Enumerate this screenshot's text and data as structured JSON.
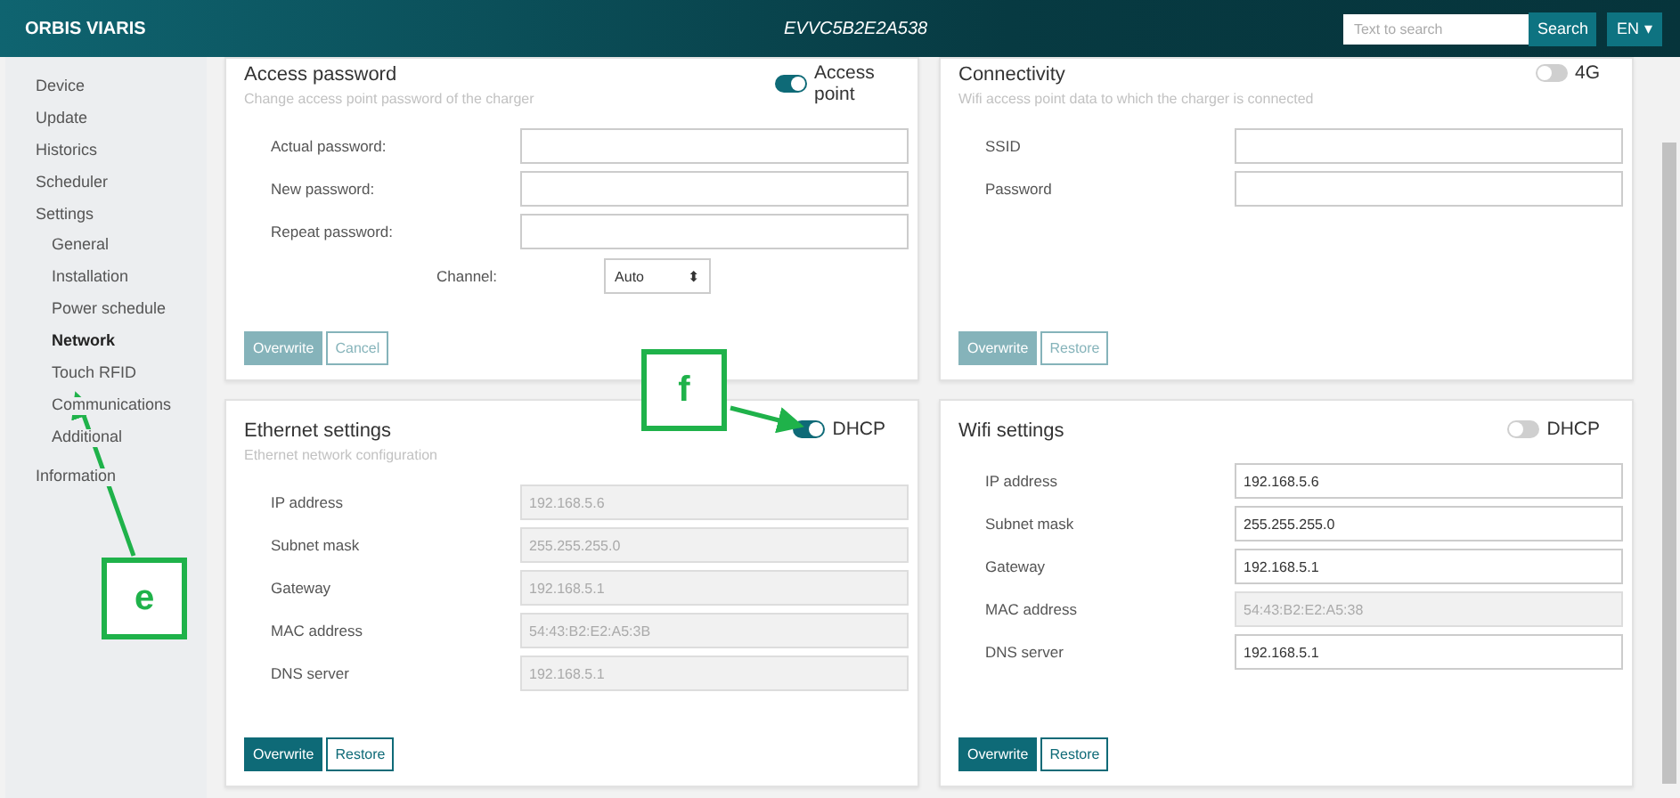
{
  "header": {
    "brand": "ORBIS VIARIS",
    "device_id": "EVVC5B2E2A538",
    "search": {
      "placeholder": "Text to search",
      "button": "Search"
    },
    "language": "EN",
    "language_caret": "▾"
  },
  "sidebar": {
    "items": [
      {
        "label": "Device",
        "selected": false
      },
      {
        "label": "Update",
        "selected": false
      },
      {
        "label": "Historics",
        "selected": false
      },
      {
        "label": "Scheduler",
        "selected": false
      },
      {
        "label": "Settings",
        "selected": false,
        "children": [
          {
            "label": "General",
            "selected": false
          },
          {
            "label": "Installation",
            "selected": false
          },
          {
            "label": "Power schedule",
            "selected": false
          },
          {
            "label": "Network",
            "selected": true
          },
          {
            "label": "Touch RFID",
            "selected": false
          },
          {
            "label": "Communications",
            "selected": false
          },
          {
            "label": "Additional",
            "selected": false
          }
        ]
      },
      {
        "label": "Information",
        "selected": false
      }
    ]
  },
  "cards": [
    {
      "title": "Access password",
      "subtitle": "Change access point password of the charger",
      "toggle": {
        "label": "Access point",
        "on": true
      },
      "fields": [
        {
          "label": "Actual password:",
          "disabled": false
        },
        {
          "label": "New password:",
          "disabled": false
        },
        {
          "label": "Repeat password:",
          "disabled": false
        }
      ],
      "select": {
        "label": "Channel:",
        "value": "Auto",
        "caret": "⬍"
      },
      "buttons": [
        {
          "label": "Overwrite",
          "kind": "primary",
          "disabled": true
        },
        {
          "label": "Cancel",
          "kind": "secondary",
          "disabled": true
        }
      ]
    },
    {
      "title": "Connectivity",
      "subtitle": "Wifi access point data to which the charger is connected",
      "toggle": {
        "label": "4G",
        "on": false
      },
      "fields": [
        {
          "label": "SSID",
          "disabled": false
        },
        {
          "label": "Password",
          "disabled": false
        }
      ],
      "buttons": [
        {
          "label": "Overwrite",
          "kind": "primary",
          "disabled": true
        },
        {
          "label": "Restore",
          "kind": "secondary",
          "disabled": true
        }
      ]
    },
    {
      "title": "Ethernet settings",
      "subtitle": "Ethernet network configuration",
      "toggle": {
        "label": "DHCP",
        "on": true
      },
      "fields": [
        {
          "label": "IP address",
          "value": "192.168.5.6",
          "disabled": true
        },
        {
          "label": "Subnet mask",
          "value": "255.255.255.0",
          "disabled": true
        },
        {
          "label": "Gateway",
          "value": "192.168.5.1",
          "disabled": true
        },
        {
          "label": "MAC address",
          "value": "54:43:B2:E2:A5:3B",
          "disabled": true
        },
        {
          "label": "DNS server",
          "value": "192.168.5.1",
          "disabled": true
        }
      ],
      "buttons": [
        {
          "label": "Overwrite",
          "kind": "primary",
          "disabled": false
        },
        {
          "label": "Restore",
          "kind": "secondary",
          "disabled": false
        }
      ]
    },
    {
      "title": "Wifi settings",
      "toggle": {
        "label": "DHCP",
        "on": false
      },
      "fields": [
        {
          "label": "IP address",
          "value": "192.168.5.6",
          "disabled": false
        },
        {
          "label": "Subnet mask",
          "value": "255.255.255.0",
          "disabled": false
        },
        {
          "label": "Gateway",
          "value": "192.168.5.1",
          "disabled": false
        },
        {
          "label": "MAC address",
          "value": "54:43:B2:E2:A5:38",
          "disabled": true
        },
        {
          "label": "DNS server",
          "value": "192.168.5.1",
          "disabled": false
        }
      ],
      "buttons": [
        {
          "label": "Overwrite",
          "kind": "primary",
          "disabled": false
        },
        {
          "label": "Restore",
          "kind": "secondary",
          "disabled": false
        }
      ]
    }
  ],
  "callouts": [
    {
      "label": "f"
    },
    {
      "label": "e"
    }
  ]
}
